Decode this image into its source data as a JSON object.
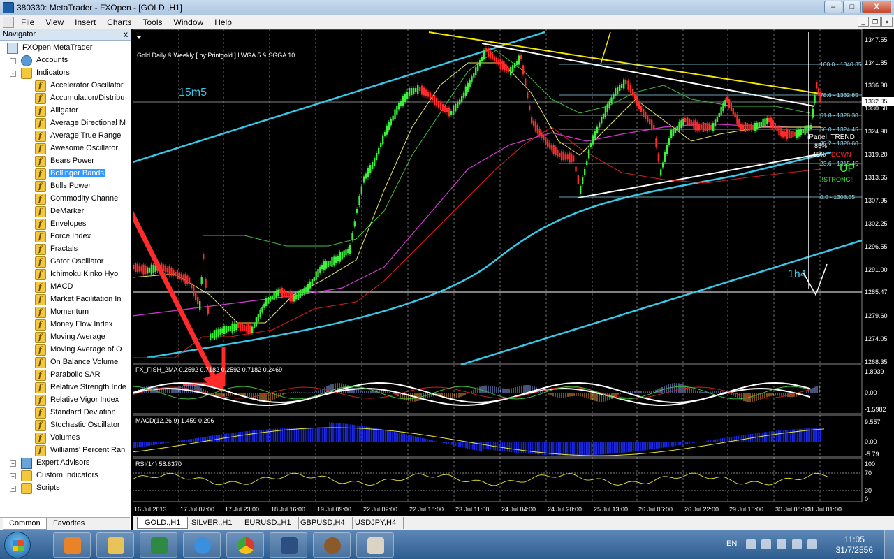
{
  "window": {
    "title": "380330: MetaTrader - FXOpen - [GOLD.,H1]",
    "buttons": {
      "minimize": "–",
      "maximize": "□",
      "close": "X"
    },
    "mdi_buttons": {
      "minimize": "_",
      "restore": "❐",
      "close": "x"
    }
  },
  "menu": [
    "File",
    "View",
    "Insert",
    "Charts",
    "Tools",
    "Window",
    "Help"
  ],
  "navigator": {
    "title": "Navigator",
    "close": "x",
    "root": "FXOpen MetaTrader",
    "accounts": "Accounts",
    "indicators_folder": "Indicators",
    "indicators": [
      "Accelerator Oscillator",
      "Accumulation/Distribu",
      "Alligator",
      "Average Directional M",
      "Average True Range",
      "Awesome Oscillator",
      "Bears Power",
      "Bollinger Bands",
      "Bulls Power",
      "Commodity Channel",
      "DeMarker",
      "Envelopes",
      "Force Index",
      "Fractals",
      "Gator Oscillator",
      "Ichimoku Kinko Hyo",
      "MACD",
      "Market Facilitation In",
      "Momentum",
      "Money Flow Index",
      "Moving Average",
      "Moving Average of O",
      "On Balance Volume",
      "Parabolic SAR",
      "Relative Strength Inde",
      "Relative Vigor Index",
      "Standard Deviation",
      "Stochastic Oscillator",
      "Volumes",
      "Williams' Percent Ran"
    ],
    "selected_index": 7,
    "folders_after": [
      "Expert Advisors",
      "Custom Indicators",
      "Scripts"
    ],
    "tabs": [
      "Common",
      "Favorites"
    ]
  },
  "chart": {
    "header": "Gold Daily & Weekly [ by:Printgold ]  LWGA 5  &  SGGA 10",
    "annotations": {
      "left": "15m5",
      "right": "1h4"
    },
    "price_axis": [
      "1347.55",
      "1341.85",
      "1336.30",
      "1330.60",
      "1324.90",
      "1319.20",
      "1313.65",
      "1307.95",
      "1302.25",
      "1296.55",
      "1291.00",
      "1285.47",
      "1279.60",
      "1274.05",
      "1268.35"
    ],
    "current_price": "1332.05",
    "line_price": "1285.47",
    "fib_levels": [
      "100.0 - 1340.35",
      "78.6 - 1332.85",
      "61.8 - 1328.30",
      "50.0 - 1324.45",
      "38.2 - 1320.60",
      "23.6 - 1315.45",
      "0.0 - 1308.55"
    ],
    "panel_trend": {
      "title": "iPanel_TREND",
      "pct_up": "85%",
      "pct_down": "15%",
      "down_label": "DOWN",
      "up_label": "UP",
      "strength": "!!STRONG!!"
    },
    "fisher": {
      "label": "FX_FISH_2MA 0.2592 0.7182 0.2592 0.7182 0.2469",
      "axis": [
        "1.8939",
        "0.00",
        "-1.5982"
      ]
    },
    "macd": {
      "label": "MACD(12,26,9) 1.459 0.296",
      "axis": [
        "9.557",
        "0.00",
        "-5.79"
      ]
    },
    "rsi": {
      "label": "RSI(14) 58.6370",
      "axis": [
        "100",
        "70",
        "30",
        "0"
      ]
    },
    "time_axis": [
      "16 Jul 2013",
      "17 Jul 07:00",
      "17 Jul 23:00",
      "18 Jul 16:00",
      "19 Jul 09:00",
      "22 Jul 02:00",
      "22 Jul 18:00",
      "23 Jul 11:00",
      "24 Jul 04:00",
      "24 Jul 20:00",
      "25 Jul 13:00",
      "26 Jul 06:00",
      "26 Jul 22:00",
      "29 Jul 15:00",
      "30 Jul 08:00",
      "31 Jul 01:00"
    ]
  },
  "chart_tabs": [
    "GOLD.,H1",
    "SILVER.,H1",
    "EURUSD.,H1",
    "GBPUSD,H4",
    "USDJPY,H4"
  ],
  "taskbar": {
    "language": "EN",
    "time": "11:05",
    "date": "31/7/2556"
  }
}
